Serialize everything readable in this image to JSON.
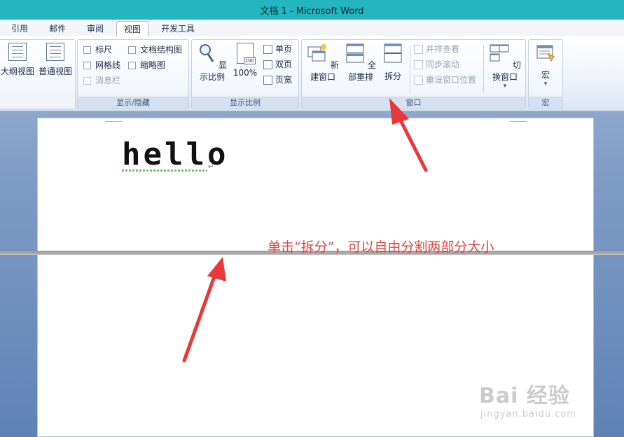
{
  "window": {
    "title": "文档 1 - Microsoft Word"
  },
  "tabs": [
    {
      "label": "引用",
      "active": false
    },
    {
      "label": "邮件",
      "active": false
    },
    {
      "label": "审阅",
      "active": false
    },
    {
      "label": "视图",
      "active": true
    },
    {
      "label": "开发工具",
      "active": false
    }
  ],
  "ribbon": {
    "views": {
      "outline_label": "大纲视图",
      "draft_label": "普通视图"
    },
    "show_hide": {
      "group_label": "显示/隐藏",
      "ruler": "标尺",
      "gridlines": "网格线",
      "message_bar": "消息栏",
      "doc_map": "文档结构图",
      "thumbnails": "缩略图"
    },
    "zoom": {
      "group_label": "显示比例",
      "zoom_label": "显示比例",
      "hundred_label": "100%",
      "hundred_badge": "100",
      "one_page": "单页",
      "two_pages": "双页",
      "page_width": "页宽"
    },
    "window": {
      "group_label": "窗口",
      "new_window": "新建窗口",
      "arrange_all": "全部重排",
      "split": "拆分",
      "side_by_side": "并排查看",
      "sync_scroll": "同步滚动",
      "reset_position": "重设窗口位置",
      "switch_windows": "切换窗口",
      "switch_caret": "▾"
    },
    "macros": {
      "group_label": "宏",
      "macros_label": "宏",
      "caret": "▾"
    }
  },
  "document": {
    "text": "hello",
    "paragraph_mark": "↵"
  },
  "annotation": {
    "text": "单击“拆分”，可以自由分割两部分大小",
    "color": "#d94a45"
  },
  "watermark": {
    "main": "Bai 经验",
    "sub": "jingyan.baidu.com"
  },
  "colors": {
    "titlebar": "#24b5c1",
    "arrow": "#e8383a"
  }
}
